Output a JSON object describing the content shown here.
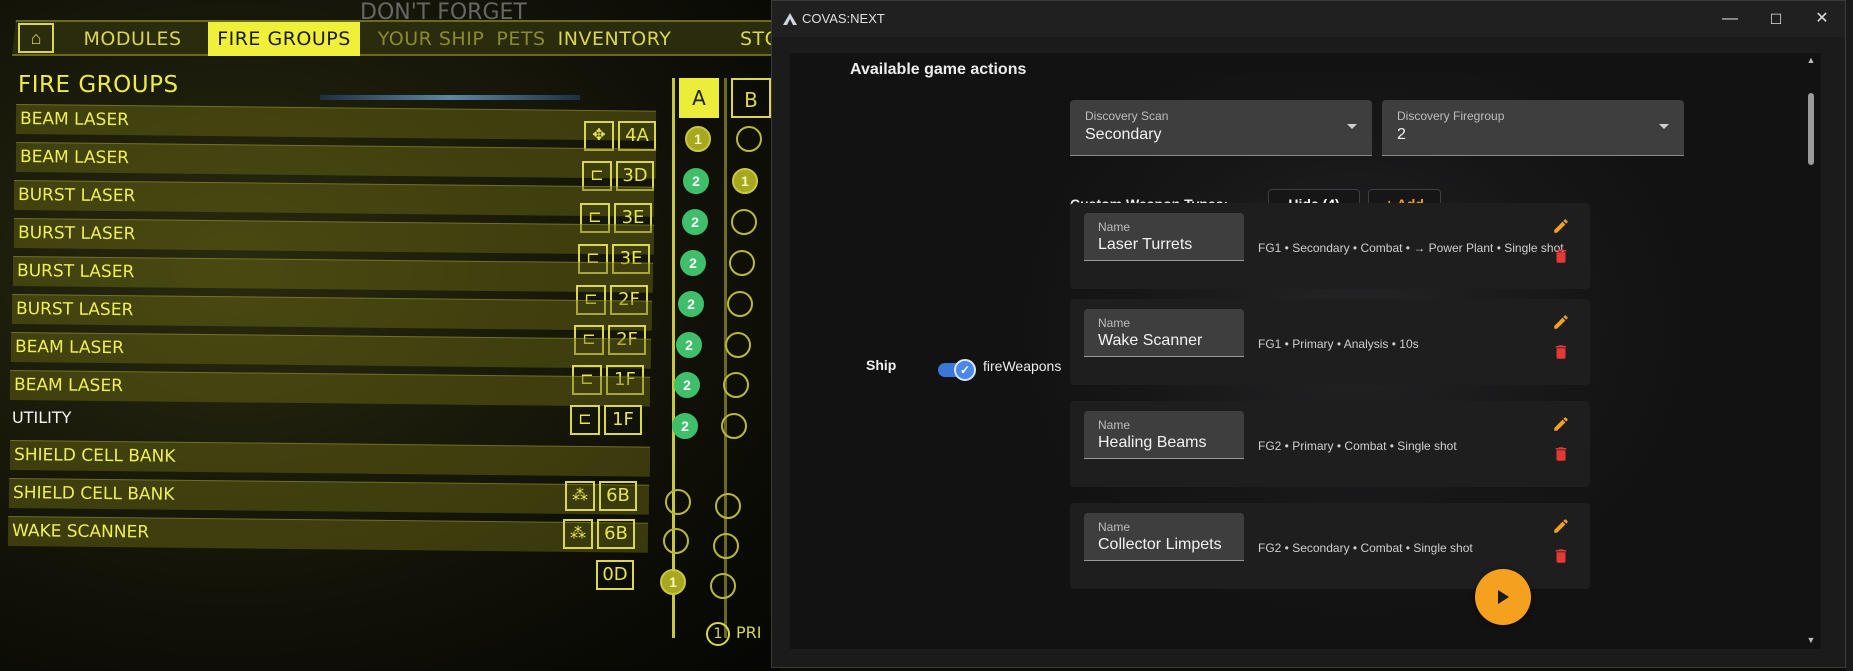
{
  "game": {
    "tabs": [
      {
        "label": "MODULES",
        "active": false
      },
      {
        "label": "FIRE GROUPS",
        "active": true
      },
      {
        "label": "YOUR SHIP",
        "active": false
      },
      {
        "label": "PETS",
        "active": false
      },
      {
        "label": "INVENTORY",
        "active": false
      },
      {
        "label": "STO",
        "active": false
      }
    ],
    "home_icon": "⌂",
    "section_title": "FIRE GROUPS",
    "columns": [
      "A",
      "B"
    ],
    "rows": [
      {
        "label": "BEAM LASER",
        "icon": "turret-icon",
        "size": "4A",
        "a": "1",
        "b": ""
      },
      {
        "label": "BEAM LASER",
        "icon": "gimbal-icon",
        "size": "3D",
        "a": "2",
        "b": "1"
      },
      {
        "label": "BURST LASER",
        "icon": "gimbal-icon",
        "size": "3E",
        "a": "2",
        "b": ""
      },
      {
        "label": "BURST LASER",
        "icon": "gimbal-icon",
        "size": "3E",
        "a": "2",
        "b": ""
      },
      {
        "label": "BURST LASER",
        "icon": "gimbal-icon",
        "size": "2F",
        "a": "2",
        "b": ""
      },
      {
        "label": "BURST LASER",
        "icon": "gimbal-icon",
        "size": "2F",
        "a": "2",
        "b": ""
      },
      {
        "label": "BEAM LASER",
        "icon": "gimbal-icon",
        "size": "1F",
        "a": "2",
        "b": ""
      },
      {
        "label": "BEAM LASER",
        "icon": "gimbal-icon",
        "size": "1F",
        "a": "2",
        "b": ""
      },
      {
        "label": "UTILITY",
        "icon": "",
        "size": "",
        "a": "",
        "b": ""
      },
      {
        "label": "SHIELD CELL BANK",
        "icon": "",
        "size": "",
        "a": "",
        "b": ""
      },
      {
        "label": "SHIELD CELL BANK",
        "icon": "scb-icon",
        "size": "6B",
        "a": "",
        "b": ""
      },
      {
        "label": "WAKE SCANNER",
        "icon": "scb-icon",
        "size": "6B",
        "a": "",
        "b": ""
      },
      {
        "label": "",
        "icon": "",
        "size": "0D",
        "a": "1",
        "b": ""
      }
    ],
    "bottom_legend": {
      "num": "1",
      "text": "PRI"
    }
  },
  "window": {
    "title": "COVAS:NEXT",
    "controls": {
      "minimize": "—",
      "maximize": "☐",
      "close": "✕"
    },
    "section_title": "Available game actions",
    "discovery_scan": {
      "label": "Discovery Scan",
      "value": "Secondary"
    },
    "discovery_firegroup": {
      "label": "Discovery Firegroup",
      "value": "2"
    },
    "custom_weapon_types_label": "Custom Weapon Types:",
    "hide_button": "Hide (4)",
    "add_button": "+ Add",
    "ship_label": "Ship",
    "toggle": {
      "label": "fireWeapons",
      "checked": true
    },
    "weapon_field_label": "Name",
    "weapons": [
      {
        "name": "Laser Turrets",
        "desc": "FG1 • Secondary • Combat • → Power Plant • Single shot"
      },
      {
        "name": "Wake Scanner",
        "desc": "FG1 • Primary • Analysis • 10s"
      },
      {
        "name": "Healing Beams",
        "desc": "FG2 • Primary • Combat • Single shot"
      },
      {
        "name": "Collector Limpets",
        "desc": "FG2 • Secondary • Combat • Single shot"
      }
    ],
    "colors": {
      "accent": "#f5a01f",
      "toggle": "#3a77d8",
      "delete": "#e53935",
      "edit": "#f5a01f"
    }
  }
}
